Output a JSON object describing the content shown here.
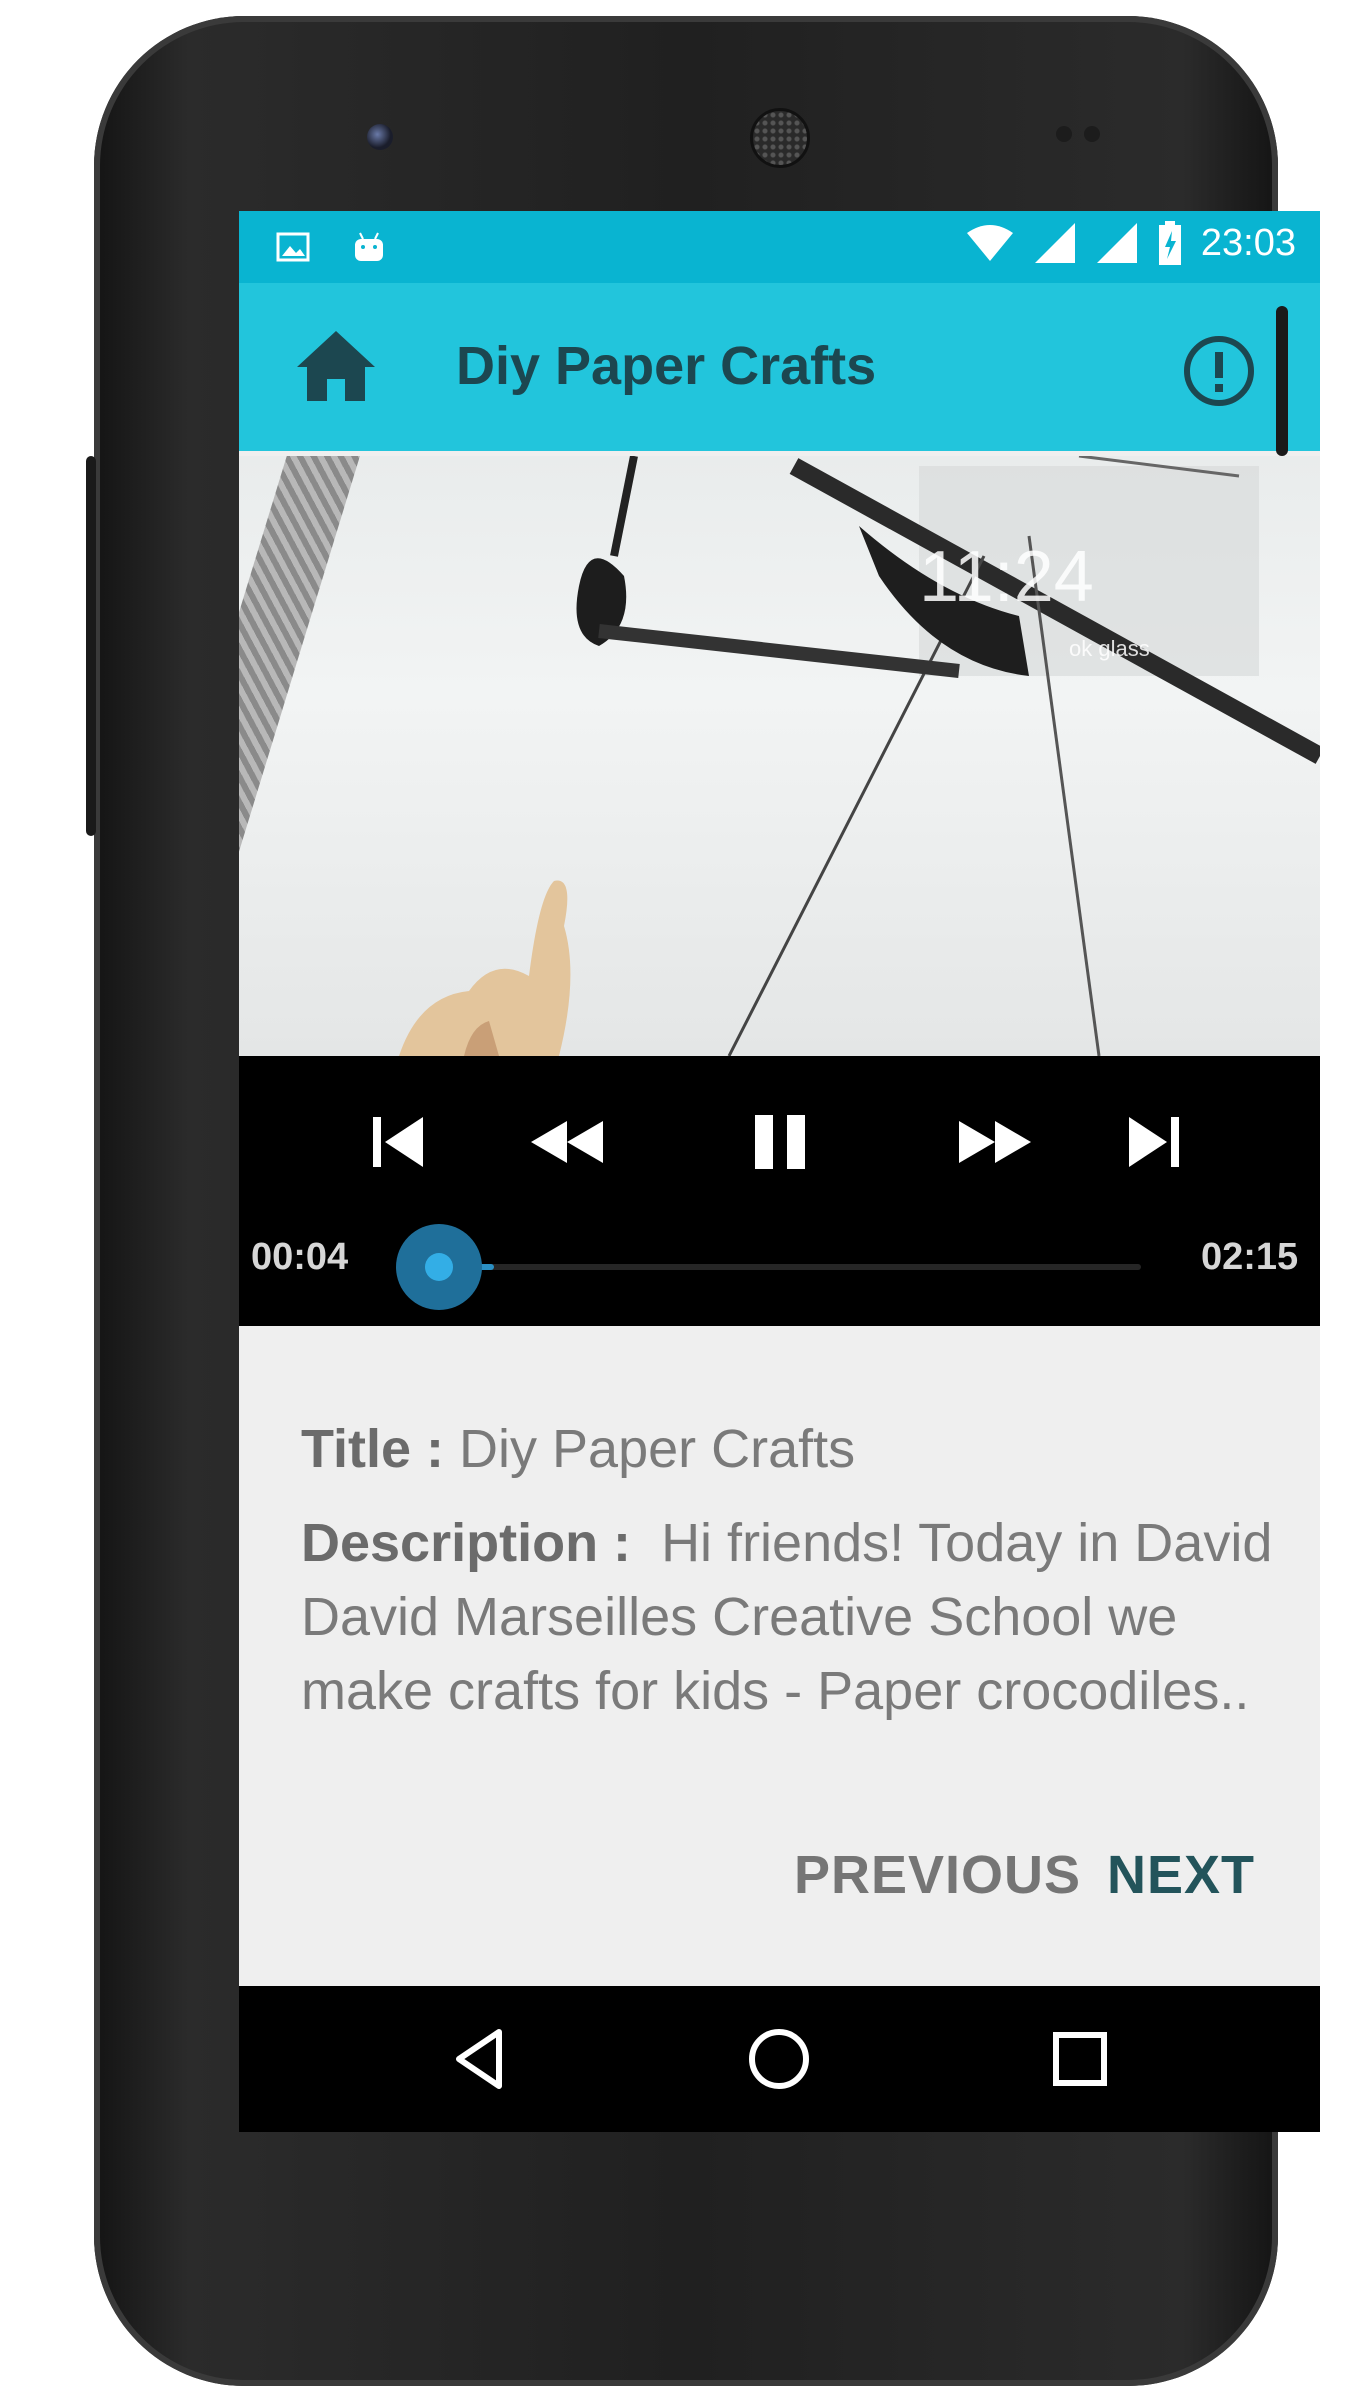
{
  "status_bar": {
    "time": "23:03",
    "left_icons": [
      "image-notification-icon",
      "android-notification-icon"
    ],
    "right_icons": [
      "wifi-icon",
      "signal-icon",
      "signal-icon-2",
      "battery-charging-icon"
    ]
  },
  "app_bar": {
    "title": "Diy Paper Crafts",
    "home_icon": "home-icon",
    "info_icon": "info-icon"
  },
  "video": {
    "overlay_clock": "11:24",
    "overlay_subtext": "ok glass"
  },
  "player": {
    "controls": [
      "skip-previous-icon",
      "rewind-icon",
      "pause-icon",
      "fast-forward-icon",
      "skip-next-icon"
    ],
    "elapsed": "00:04",
    "duration": "02:15",
    "progress_fraction": 0.03,
    "accent_color": "#33aee6"
  },
  "details": {
    "title_label": "Title :",
    "title_value": "Diy Paper Crafts",
    "description_label": "Description :",
    "description_value": "Hi friends! Today in David David Marseilles Creative  School we make crafts for kids - Paper crocodiles.."
  },
  "actions": {
    "previous_label": "PREVIOUS",
    "next_label": "NEXT"
  },
  "nav_bar": {
    "icons": [
      "back-icon",
      "home-circle-icon",
      "recents-icon"
    ]
  },
  "theme": {
    "status_bar_color": "#09b4d1",
    "app_bar_color": "#22c5dc",
    "title_color": "#1c4750"
  }
}
